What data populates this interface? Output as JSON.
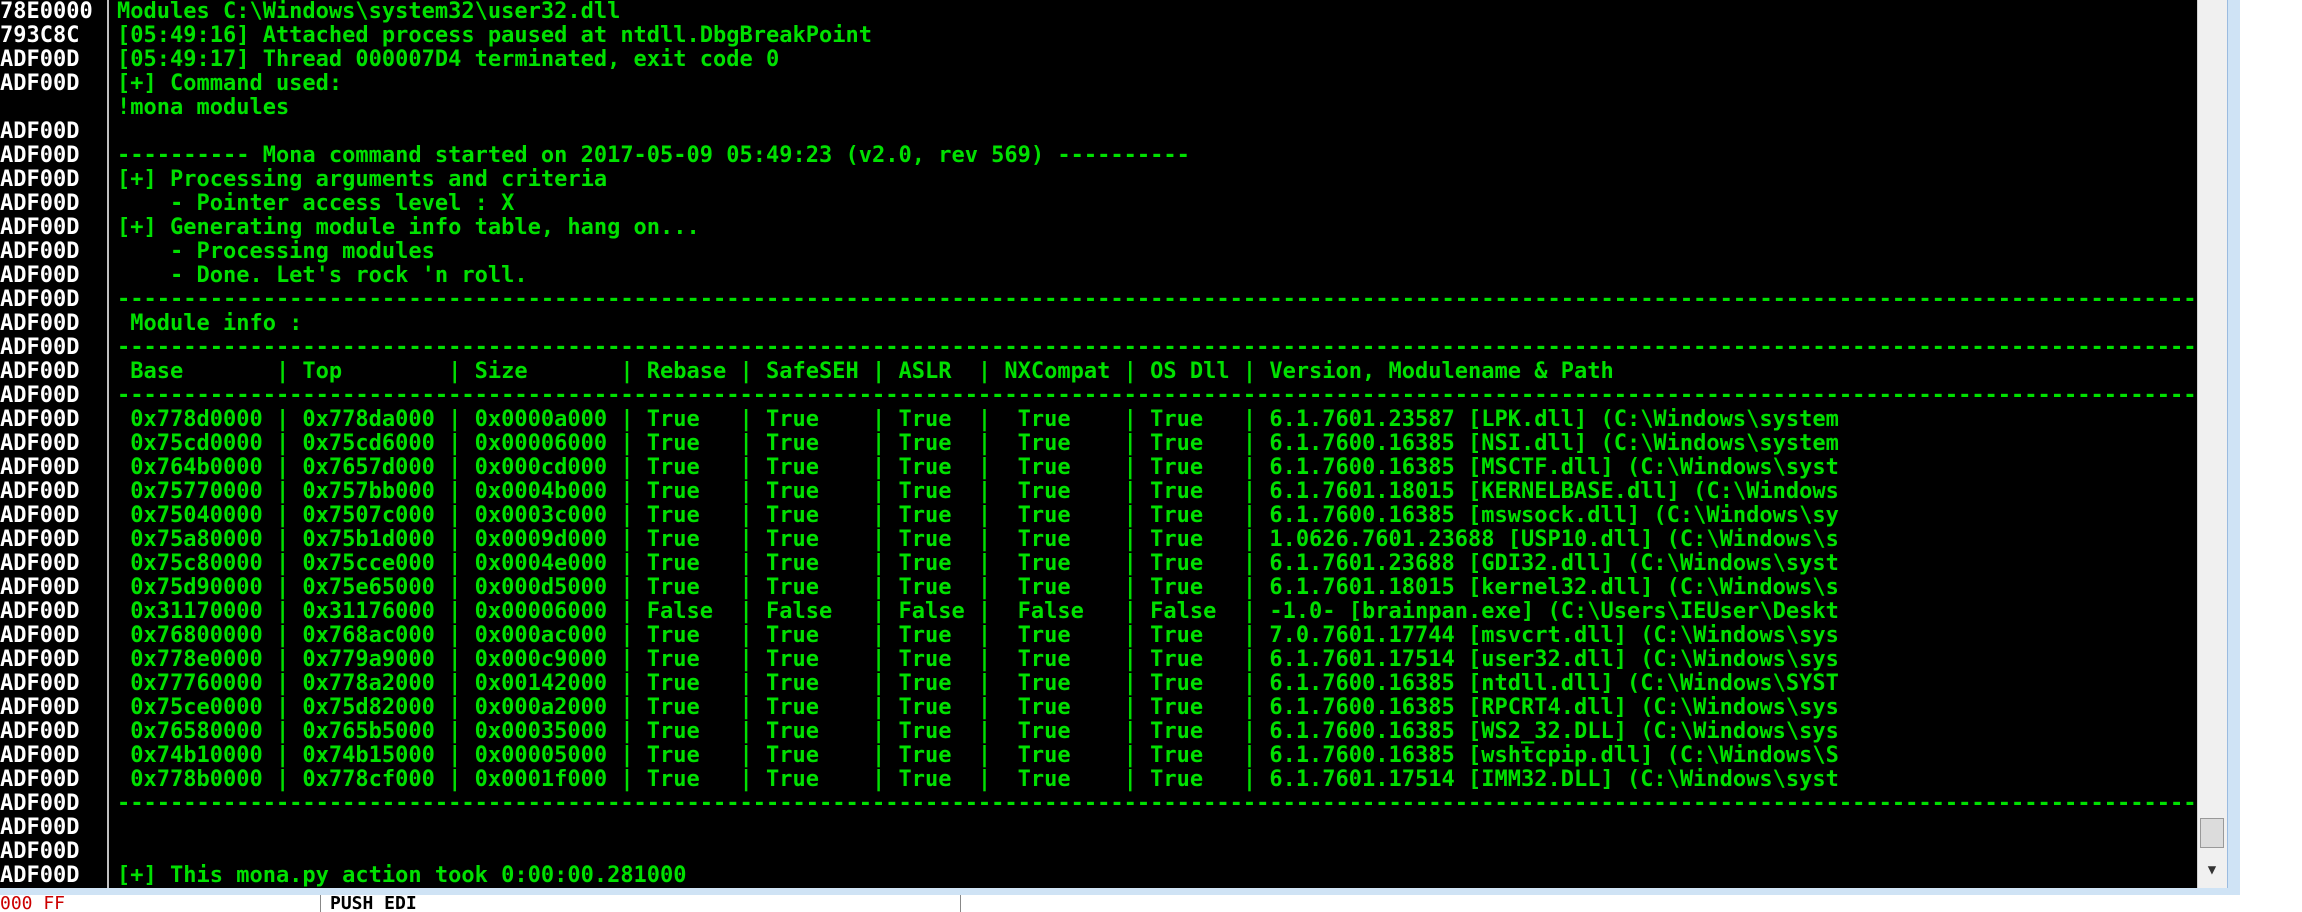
{
  "window": {
    "addresses": [
      "78E0000",
      "793C8C",
      "ADF00D",
      "ADF00D",
      "",
      "ADF00D",
      "ADF00D",
      "ADF00D",
      "ADF00D",
      "ADF00D",
      "ADF00D",
      "ADF00D",
      "ADF00D",
      "ADF00D",
      "ADF00D",
      "ADF00D",
      "ADF00D",
      "ADF00D",
      "ADF00D",
      "ADF00D",
      "ADF00D",
      "ADF00D",
      "ADF00D",
      "ADF00D",
      "ADF00D",
      "ADF00D",
      "ADF00D",
      "ADF00D",
      "ADF00D",
      "ADF00D",
      "ADF00D",
      "ADF00D",
      "ADF00D",
      "ADF00D",
      "ADF00D",
      "ADF00D",
      "ADF00D"
    ],
    "header_lines": [
      "Modules C:\\Windows\\system32\\user32.dll",
      "[05:49:16] Attached process paused at ntdll.DbgBreakPoint",
      "[05:49:17] Thread 000007D4 terminated, exit code 0",
      "[+] Command used:",
      "!mona modules"
    ],
    "mona_lines": [
      "---------- Mona command started on 2017-05-09 05:49:23 (v2.0, rev 569) ----------",
      "[+] Processing arguments and criteria",
      "    - Pointer access level : X",
      "[+] Generating module info table, hang on...",
      "    - Processing modules",
      "    - Done. Let's rock 'n roll."
    ],
    "separator": "------------------------------------------------------------------------------------------------------------------------------------------------------------------------------------------------",
    "module_info_title": " Module info :",
    "table": {
      "header": " Base       | Top        | Size       | Rebase | SafeSEH | ASLR  | NXCompat | OS Dll | Version, Modulename & Path",
      "rows": [
        " 0x778d0000 | 0x778da000 | 0x0000a000 | True   | True    | True  |  True    | True   | 6.1.7601.23587 [LPK.dll] (C:\\Windows\\system",
        " 0x75cd0000 | 0x75cd6000 | 0x00006000 | True   | True    | True  |  True    | True   | 6.1.7600.16385 [NSI.dll] (C:\\Windows\\system",
        " 0x764b0000 | 0x7657d000 | 0x000cd000 | True   | True    | True  |  True    | True   | 6.1.7600.16385 [MSCTF.dll] (C:\\Windows\\syst",
        " 0x75770000 | 0x757bb000 | 0x0004b000 | True   | True    | True  |  True    | True   | 6.1.7601.18015 [KERNELBASE.dll] (C:\\Windows",
        " 0x75040000 | 0x7507c000 | 0x0003c000 | True   | True    | True  |  True    | True   | 6.1.7600.16385 [mswsock.dll] (C:\\Windows\\sy",
        " 0x75a80000 | 0x75b1d000 | 0x0009d000 | True   | True    | True  |  True    | True   | 1.0626.7601.23688 [USP10.dll] (C:\\Windows\\s",
        " 0x75c80000 | 0x75cce000 | 0x0004e000 | True   | True    | True  |  True    | True   | 6.1.7601.23688 [GDI32.dll] (C:\\Windows\\syst",
        " 0x75d90000 | 0x75e65000 | 0x000d5000 | True   | True    | True  |  True    | True   | 6.1.7601.18015 [kernel32.dll] (C:\\Windows\\s",
        " 0x31170000 | 0x31176000 | 0x00006000 | False  | False   | False |  False   | False  | -1.0- [brainpan.exe] (C:\\Users\\IEUser\\Deskt",
        " 0x76800000 | 0x768ac000 | 0x000ac000 | True   | True    | True  |  True    | True   | 7.0.7601.17744 [msvcrt.dll] (C:\\Windows\\sys",
        " 0x778e0000 | 0x779a9000 | 0x000c9000 | True   | True    | True  |  True    | True   | 6.1.7601.17514 [user32.dll] (C:\\Windows\\sys",
        " 0x77760000 | 0x778a2000 | 0x00142000 | True   | True    | True  |  True    | True   | 6.1.7600.16385 [ntdll.dll] (C:\\Windows\\SYST",
        " 0x75ce0000 | 0x75d82000 | 0x000a2000 | True   | True    | True  |  True    | True   | 6.1.7600.16385 [RPCRT4.dll] (C:\\Windows\\sys",
        " 0x76580000 | 0x765b5000 | 0x00035000 | True   | True    | True  |  True    | True   | 6.1.7600.16385 [WS2_32.DLL] (C:\\Windows\\sys",
        " 0x74b10000 | 0x74b15000 | 0x00005000 | True   | True    | True  |  True    | True   | 6.1.7600.16385 [wshtcpip.dll] (C:\\Windows\\S",
        " 0x778b0000 | 0x778cf000 | 0x0001f000 | True   | True    | True  |  True    | True   | 6.1.7601.17514 [IMM32.DLL] (C:\\Windows\\syst"
      ]
    },
    "footer_line": "[+] This mona.py action took 0:00:00.281000"
  },
  "bottom": {
    "left_text": "000  FF",
    "command": "PUSH EDI"
  },
  "colors": {
    "log_text": "#00e000",
    "address_text": "#ffffff",
    "background": "#000000"
  }
}
